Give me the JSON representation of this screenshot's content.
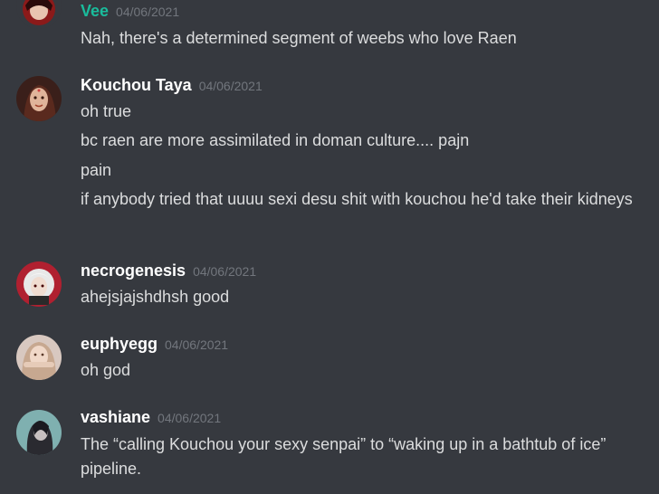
{
  "messages": [
    {
      "author": "Vee",
      "time": "04/06/2021",
      "lines": [
        "Nah, there's a determined segment of weebs who love Raen"
      ]
    },
    {
      "author": "Kouchou Taya",
      "time": "04/06/2021",
      "lines": [
        "oh true",
        "bc raen are more assimilated in doman culture.... pajn",
        "pain",
        "if anybody tried that uuuu sexi desu shit with kouchou he'd take their kidneys"
      ]
    },
    {
      "author": "necrogenesis",
      "time": "04/06/2021",
      "lines": [
        "ahejsjajshdhsh good"
      ]
    },
    {
      "author": "euphyegg",
      "time": "04/06/2021",
      "lines": [
        "oh god"
      ]
    },
    {
      "author": "vashiane",
      "time": "04/06/2021",
      "lines": [
        "The “calling Kouchou your sexy senpai” to “waking up in a bathtub of ice” pipeline."
      ]
    }
  ],
  "colors": {
    "background": "#36393f",
    "username_default": "#ffffff",
    "username_vee": "#1abc9c",
    "timestamp": "#72767d",
    "text": "#dcddde"
  }
}
